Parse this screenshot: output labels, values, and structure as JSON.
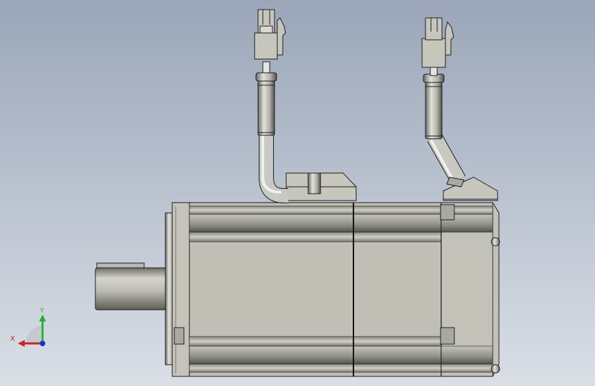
{
  "viewport": {
    "background_top": "#9aa6b8",
    "background_bottom": "#dadfe6"
  },
  "model": {
    "body_color": "#bfbfb6",
    "body_shadow": "#6f6f69",
    "edge_color": "#1a1a1a",
    "cable_color": "#c9c9c3"
  },
  "triad": {
    "x_label": "X",
    "y_label": "Y",
    "x_color": "#d21f1f",
    "y_color": "#22b22b",
    "z_color": "#1b2fd0"
  }
}
